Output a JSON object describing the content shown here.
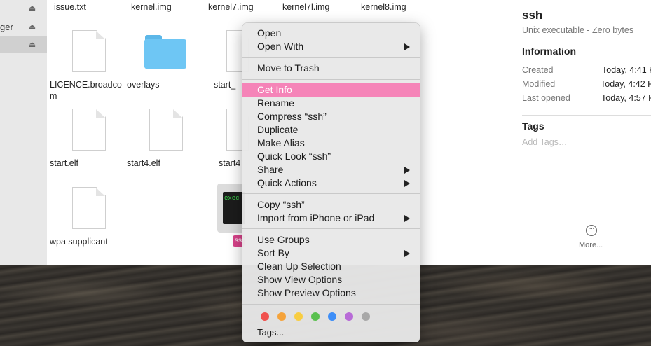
{
  "sidebar": {
    "rows": [
      {
        "text": "",
        "selected": false
      },
      {
        "text": "ger",
        "selected": false
      },
      {
        "text": "",
        "selected": true
      }
    ]
  },
  "files": {
    "top_row_labels": [
      "issue.txt",
      "kernel.img",
      "kernel7.img",
      "kernel7l.img",
      "kernel8.img"
    ],
    "items": [
      {
        "label": "LICENCE.broadcom"
      },
      {
        "label": "overlays"
      },
      {
        "label": "start_"
      },
      {
        "label": "start.elf"
      },
      {
        "label": "start4.elf"
      },
      {
        "label": "start4"
      },
      {
        "label": "wpa supplicant"
      }
    ],
    "exec_icon_text": "exec",
    "selected_badge": "ssh"
  },
  "inspector": {
    "title": "ssh",
    "subtitle": "Unix executable - Zero bytes",
    "information_heading": "Information",
    "rows": [
      {
        "key": "Created",
        "value": "Today, 4:41 P"
      },
      {
        "key": "Modified",
        "value": "Today, 4:42 P"
      },
      {
        "key": "Last opened",
        "value": "Today, 4:57 P"
      }
    ],
    "tags_heading": "Tags",
    "tags_placeholder": "Add Tags…",
    "more_label": "More..."
  },
  "context_menu": {
    "open": "Open",
    "open_with": "Open With",
    "move_to_trash": "Move to Trash",
    "get_info": "Get Info",
    "rename": "Rename",
    "compress": "Compress “ssh”",
    "duplicate": "Duplicate",
    "make_alias": "Make Alias",
    "quick_look": "Quick Look “ssh”",
    "share": "Share",
    "quick_actions": "Quick Actions",
    "copy": "Copy “ssh”",
    "import_from": "Import from iPhone or iPad",
    "use_groups": "Use Groups",
    "sort_by": "Sort By",
    "clean_up": "Clean Up Selection",
    "show_view_options": "Show View Options",
    "show_preview_options": "Show Preview Options",
    "tags": "Tags...",
    "tag_colors": [
      "#f0524f",
      "#f5a33b",
      "#f8cd41",
      "#5ac04f",
      "#3e8ef7",
      "#b86bd7",
      "#a8a8a8"
    ],
    "highlight_color": "#f584b8"
  }
}
